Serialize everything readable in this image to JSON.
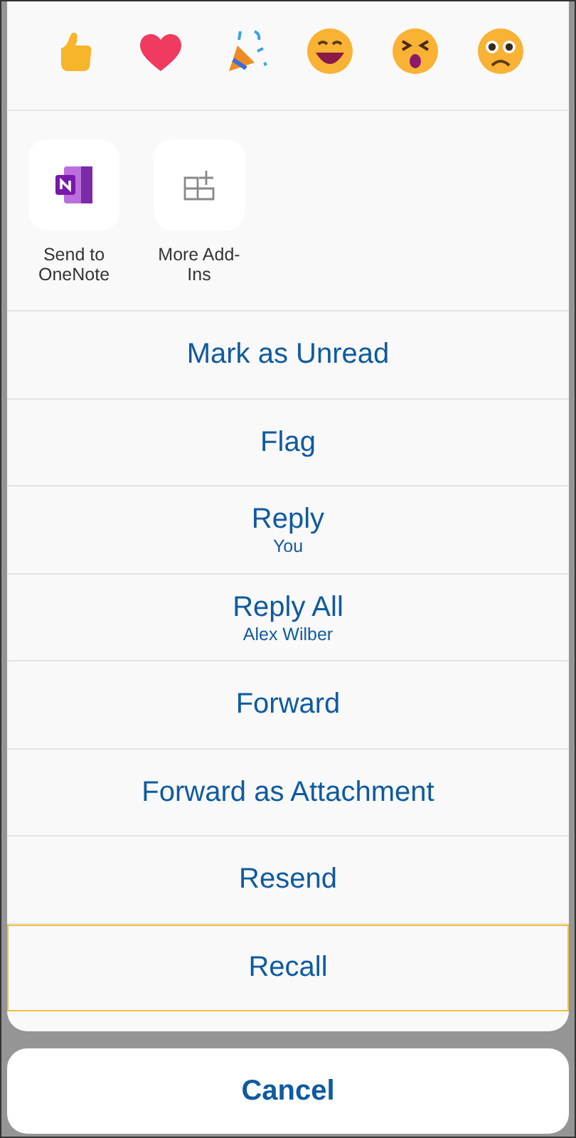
{
  "reactions": [
    {
      "kind": "thumbs-up"
    },
    {
      "kind": "heart"
    },
    {
      "kind": "party"
    },
    {
      "kind": "grin"
    },
    {
      "kind": "squint"
    },
    {
      "kind": "worried"
    }
  ],
  "add_ins": [
    {
      "kind": "onenote",
      "label": "Send to OneNote"
    },
    {
      "kind": "more",
      "label": "More Add-Ins"
    }
  ],
  "actions": [
    {
      "label": "Mark as Unread",
      "selected": false
    },
    {
      "label": "Flag",
      "selected": false
    },
    {
      "label": "Reply",
      "sublabel": "You",
      "selected": false
    },
    {
      "label": "Reply All",
      "sublabel": "Alex Wilber",
      "selected": false
    },
    {
      "label": "Forward",
      "selected": false
    },
    {
      "label": "Forward as Attachment",
      "selected": false
    },
    {
      "label": "Resend",
      "selected": false
    },
    {
      "label": "Recall",
      "selected": true
    }
  ],
  "cancel": "Cancel"
}
